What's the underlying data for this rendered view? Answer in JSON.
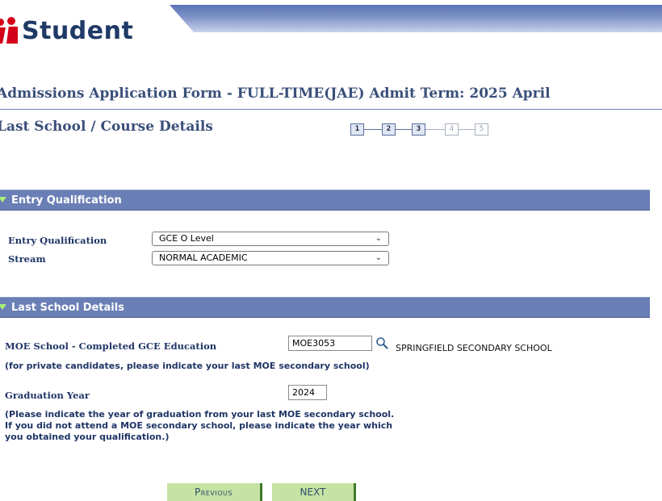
{
  "header": {
    "logo_text": "Student"
  },
  "page": {
    "title": "Admissions Application Form - FULL-TIME(JAE)   Admit Term: 2025 April",
    "section_title": "Last School / Course Details"
  },
  "steps": [
    {
      "label": "1",
      "state": "done"
    },
    {
      "label": "2",
      "state": "done"
    },
    {
      "label": "3",
      "state": "current"
    },
    {
      "label": "4",
      "state": "disabled"
    },
    {
      "label": "5",
      "state": "disabled"
    }
  ],
  "entry_qualification": {
    "header": "Entry Qualification",
    "qualification_label": "Entry Qualification",
    "qualification_value": "GCE O Level",
    "stream_label": "Stream",
    "stream_value": "NORMAL ACADEMIC"
  },
  "last_school": {
    "header": "Last School Details",
    "moe_label": "MOE School - Completed GCE Education",
    "moe_code": "MOE3053",
    "school_name": "SPRINGFIELD SECONDARY SCHOOL",
    "private_note": "(for private candidates, please indicate your last MOE secondary school)",
    "grad_label": "Graduation Year",
    "grad_year": "2024",
    "grad_help_1": "(Please indicate the year of graduation from your last MOE secondary school.",
    "grad_help_2": "If you did not attend a MOE secondary school, please indicate the year which",
    "grad_help_3": "you obtained your qualification.)"
  },
  "buttons": {
    "previous": "Previous",
    "next": "NEXT"
  },
  "icons": {
    "search": "search-icon",
    "dropdown": "chevron-down-icon",
    "collapse": "triangle-down-icon"
  },
  "colors": {
    "section_bar": "#6a7fb5",
    "button_bg": "#c6e3a3",
    "logo_red": "#d4001a",
    "title_blue": "#3a4f7a"
  }
}
